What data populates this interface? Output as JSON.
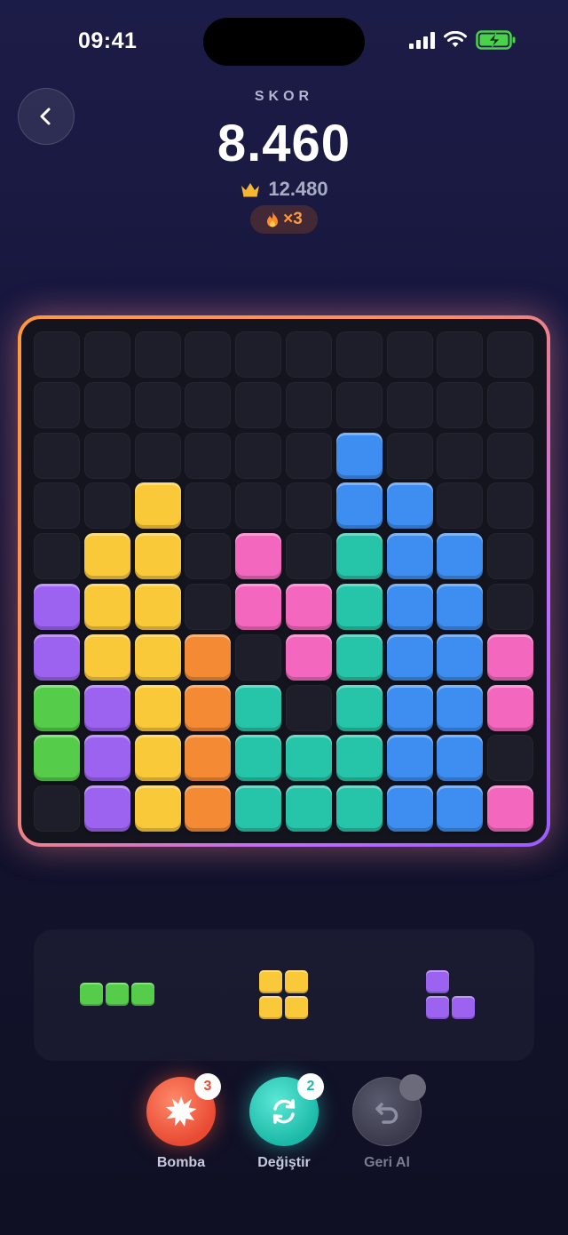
{
  "status_bar": {
    "time": "09:41"
  },
  "header": {
    "score_label": "SKOR",
    "score": "8.460",
    "best": "12.480",
    "combo": "×3"
  },
  "colors": {
    "yellow": "#f9c93a",
    "blue": "#3d8ef0",
    "teal": "#26c4a8",
    "pink": "#f467bf",
    "purple": "#9c63f0",
    "orange": "#f58a35",
    "green": "#55cc4a",
    "empty": "#1e1e2b"
  },
  "board": [
    [
      ".",
      ".",
      ".",
      ".",
      ".",
      ".",
      ".",
      ".",
      ".",
      "."
    ],
    [
      ".",
      ".",
      ".",
      ".",
      ".",
      ".",
      ".",
      ".",
      ".",
      "."
    ],
    [
      ".",
      ".",
      ".",
      ".",
      ".",
      ".",
      "B",
      ".",
      ".",
      "."
    ],
    [
      ".",
      ".",
      "Y",
      ".",
      ".",
      ".",
      "B",
      "B",
      ".",
      "."
    ],
    [
      ".",
      "Y",
      "Y",
      ".",
      "K",
      ".",
      "T",
      "B",
      "B",
      "."
    ],
    [
      "P",
      "Y",
      "Y",
      ".",
      "K",
      "K",
      "T",
      "B",
      "B",
      "."
    ],
    [
      "P",
      "Y",
      "Y",
      "O",
      ".",
      "K",
      "T",
      "B",
      "B",
      "K"
    ],
    [
      "G",
      "P",
      "Y",
      "O",
      "T",
      ".",
      "T",
      "B",
      "B",
      "K"
    ],
    [
      "G",
      "P",
      "Y",
      "O",
      "T",
      "T",
      "T",
      "B",
      "B",
      "."
    ],
    [
      ".",
      "P",
      "Y",
      "O",
      "T",
      "T",
      "T",
      "B",
      "B",
      "K"
    ]
  ],
  "color_key": {
    "Y": "yellow",
    "B": "blue",
    "T": "teal",
    "K": "pink",
    "P": "purple",
    "O": "orange",
    "G": "green"
  },
  "tray": [
    {
      "name": "green-i3-piece",
      "color": "green",
      "cells": [
        [
          0,
          0
        ],
        [
          0,
          1
        ],
        [
          0,
          2
        ]
      ]
    },
    {
      "name": "yellow-square-piece",
      "color": "yellow",
      "cells": [
        [
          0,
          0
        ],
        [
          0,
          1
        ],
        [
          1,
          0
        ],
        [
          1,
          1
        ]
      ]
    },
    {
      "name": "purple-l-piece",
      "color": "purple",
      "cells": [
        [
          0,
          0
        ],
        [
          1,
          0
        ],
        [
          1,
          1
        ]
      ]
    }
  ],
  "powerups": {
    "bomb": {
      "label": "Bomba",
      "count": "3"
    },
    "swap": {
      "label": "Değiştir",
      "count": "2"
    },
    "undo": {
      "label": "Geri Al"
    }
  }
}
